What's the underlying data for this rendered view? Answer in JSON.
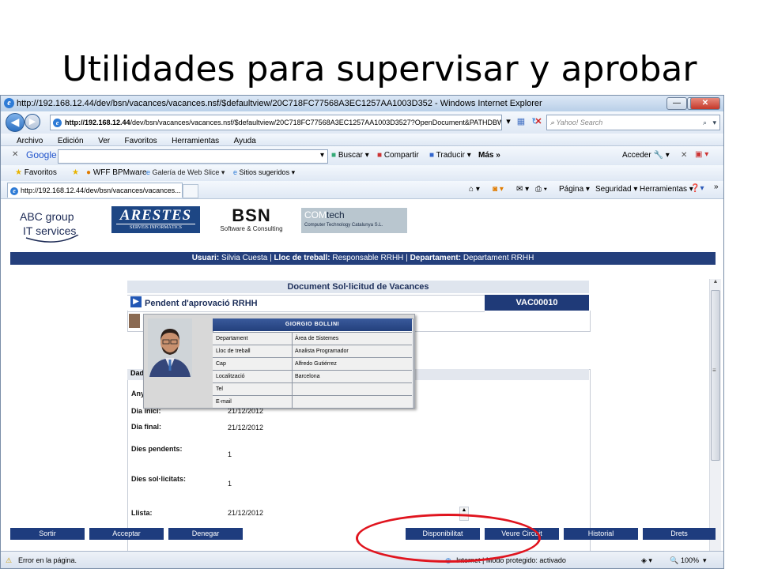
{
  "slide": {
    "title": "Utilidades para supervisar y aprobar"
  },
  "window": {
    "title": "http://192.168.12.44/dev/bsn/vacances/vacances.nsf/$defaultview/20C718FC77568A3EC1257AA1003D352 - Windows Internet Explorer",
    "address": "http://192.168.12.44/dev/bsn/vacances/vacances.nsf/$defaultview/20C718FC77568A3EC1257AA1003D3527?OpenDocument&PATHDBWFF",
    "address_host": "http://192.168.12.44",
    "address_path": "/dev/bsn/vacances/vacances.nsf/$defaultview/20C718FC77568A3EC1257AA1003D3527?OpenDocument&PATHDBWFF",
    "search_placeholder": "Yahoo! Search",
    "menu": [
      "Archivo",
      "Edición",
      "Ver",
      "Favoritos",
      "Herramientas",
      "Ayuda"
    ],
    "google": {
      "label": "Google",
      "buscar": "Buscar",
      "compartir": "Compartir",
      "traducir": "Traducir",
      "mas": "Más »",
      "acceder": "Acceder"
    },
    "favorites": {
      "label": "Favoritos",
      "items": [
        "WFF BPMware",
        "Galería de Web Slice",
        "Sitios sugeridos"
      ]
    },
    "tab_label": "http://192.168.12.44/dev/bsn/vacances/vacances...",
    "cmd": {
      "pagina": "Página",
      "seguridad": "Seguridad",
      "herramientas": "Herramientas"
    },
    "status_left": "Error en la página.",
    "status_zone": "Internet | Modo protegido: activado",
    "zoom": "100%"
  },
  "page": {
    "logos": {
      "abc_line1": "ABC group",
      "abc_line2": "IT services",
      "arestes": "ARESTES",
      "arestes_sub": "SERVEIS INFORMÀTICS",
      "bsn": "BSN",
      "bsn_sub": "Software & Consulting",
      "comtech_com": "COM",
      "comtech_tech": "tech",
      "comtech_sub": "Computer Technology Catalunya S.L."
    },
    "userbar": {
      "usuari_label": "Usuari:",
      "usuari": "Silvia Cuesta",
      "lloc_label": "Lloc de treball:",
      "lloc": "Responsable RRHH",
      "dept_label": "Departament:",
      "dept": "Departament RRHH"
    },
    "doc_title": "Document Sol·licitud de Vacances",
    "status_text": "Pendent d'aprovació RRHH",
    "doc_id": "VAC00010",
    "data_header": "Dad",
    "fields": [
      {
        "label": "Any",
        "value": ""
      },
      {
        "label": "Dia inici:",
        "value": "21/12/2012"
      },
      {
        "label": "Dia final:",
        "value": "21/12/2012"
      },
      {
        "label": "Dies pendents:",
        "value": "1"
      },
      {
        "label": "Dies sol·licitats:",
        "value": "1"
      },
      {
        "label": "Llista:",
        "value": "21/12/2012"
      }
    ],
    "popup": {
      "name": "GIORGIO BOLLINI",
      "rows": [
        {
          "k": "Departament",
          "v": "Àrea de Sistemes"
        },
        {
          "k": "Lloc de treball",
          "v": "Analista Programador"
        },
        {
          "k": "Cap",
          "v": "Alfredo Gutiérrez"
        },
        {
          "k": "Localització",
          "v": "Barcelona"
        },
        {
          "k": "Tel",
          "v": ""
        },
        {
          "k": "E-mail",
          "v": ""
        }
      ]
    },
    "buttons": [
      "Sortir",
      "Acceptar",
      "Denegar",
      "Disponibilitat",
      "Veure Circuit",
      "Historial",
      "Drets"
    ]
  },
  "colors": {
    "accent": "#1e3c7e",
    "highlight": "#e0141e"
  }
}
